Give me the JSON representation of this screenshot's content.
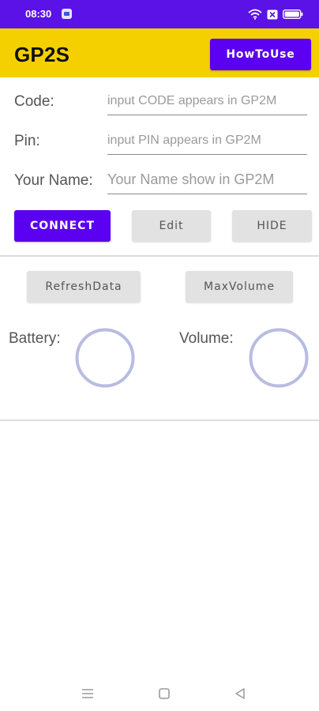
{
  "status_bar": {
    "time": "08:30",
    "icons": [
      "notification-app-icon",
      "wifi-icon",
      "sim-x-icon",
      "battery-icon"
    ],
    "background_color": "#5a12e6"
  },
  "app_bar": {
    "title": "GP2S",
    "howto_label": "HowToUse",
    "background_color": "#f5d000"
  },
  "form": {
    "code": {
      "label": "Code:",
      "value": "",
      "placeholder": "input CODE appears in GP2M"
    },
    "pin": {
      "label": "Pin:",
      "value": "",
      "placeholder": "input PIN appears in GP2M"
    },
    "name": {
      "label": "Your Name:",
      "value": "",
      "placeholder": "Your Name show in GP2M"
    }
  },
  "actions": {
    "connect_label": "CONNECT",
    "edit_label": "Edit",
    "hide_label": "HIDE"
  },
  "device": {
    "refresh_label": "RefreshData",
    "maxvolume_label": "MaxVolume",
    "battery_label": "Battery:",
    "volume_label": "Volume:"
  },
  "nav_bar": {
    "icons": [
      "menu-icon",
      "home-square-icon",
      "back-triangle-icon"
    ]
  },
  "colors": {
    "accent": "#5b00f0",
    "gauge_ring": "#b8bce0"
  }
}
